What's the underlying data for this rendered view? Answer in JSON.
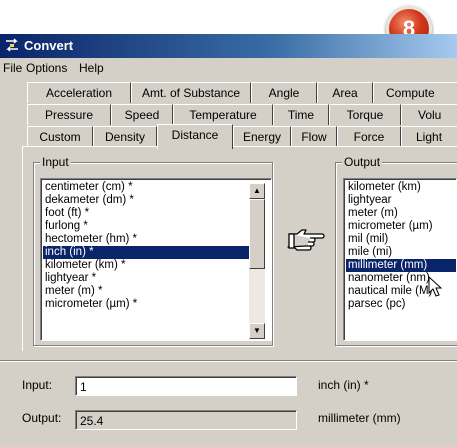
{
  "badge": "8",
  "window": {
    "title": "Convert"
  },
  "menu": [
    "File",
    "Options",
    "Help"
  ],
  "tabs": {
    "row1": [
      "Acceleration",
      "Amt. of Substance",
      "Angle",
      "Area",
      "Compute"
    ],
    "row2": [
      "Pressure",
      "Speed",
      "Temperature",
      "Time",
      "Torque",
      "Volu"
    ],
    "row3": [
      "Custom",
      "Density",
      "Distance",
      "Energy",
      "Flow",
      "Force",
      "Light"
    ],
    "active": "Distance"
  },
  "input_group": {
    "label": "Input",
    "items": [
      "centimeter (cm) *",
      "dekameter (dm) *",
      "foot (ft) *",
      "furlong *",
      "hectometer (hm) *",
      "inch (in) *",
      "kilometer (km) *",
      "lightyear *",
      "meter (m) *",
      "micrometer (µm) *"
    ],
    "selected": "inch (in) *"
  },
  "output_group": {
    "label": "Output",
    "items": [
      "kilometer (km)",
      "lightyear",
      "meter (m)",
      "micrometer (µm)",
      "mil (mil)",
      "mile (mi)",
      "millimeter (mm)",
      "nanometer (nm)",
      "nautical mile (M)",
      "parsec (pc)"
    ],
    "selected": "millimeter (mm)"
  },
  "convert_icon": "pointing-hand-icon",
  "input": {
    "label": "Input:",
    "value": "1",
    "unit": "inch (in) *"
  },
  "output": {
    "label": "Output:",
    "value": "25.4",
    "unit": "millimeter (mm)"
  },
  "colors": {
    "selection": "#0a246a",
    "titlebar": "#0a246a",
    "badge": "#d0381c"
  }
}
